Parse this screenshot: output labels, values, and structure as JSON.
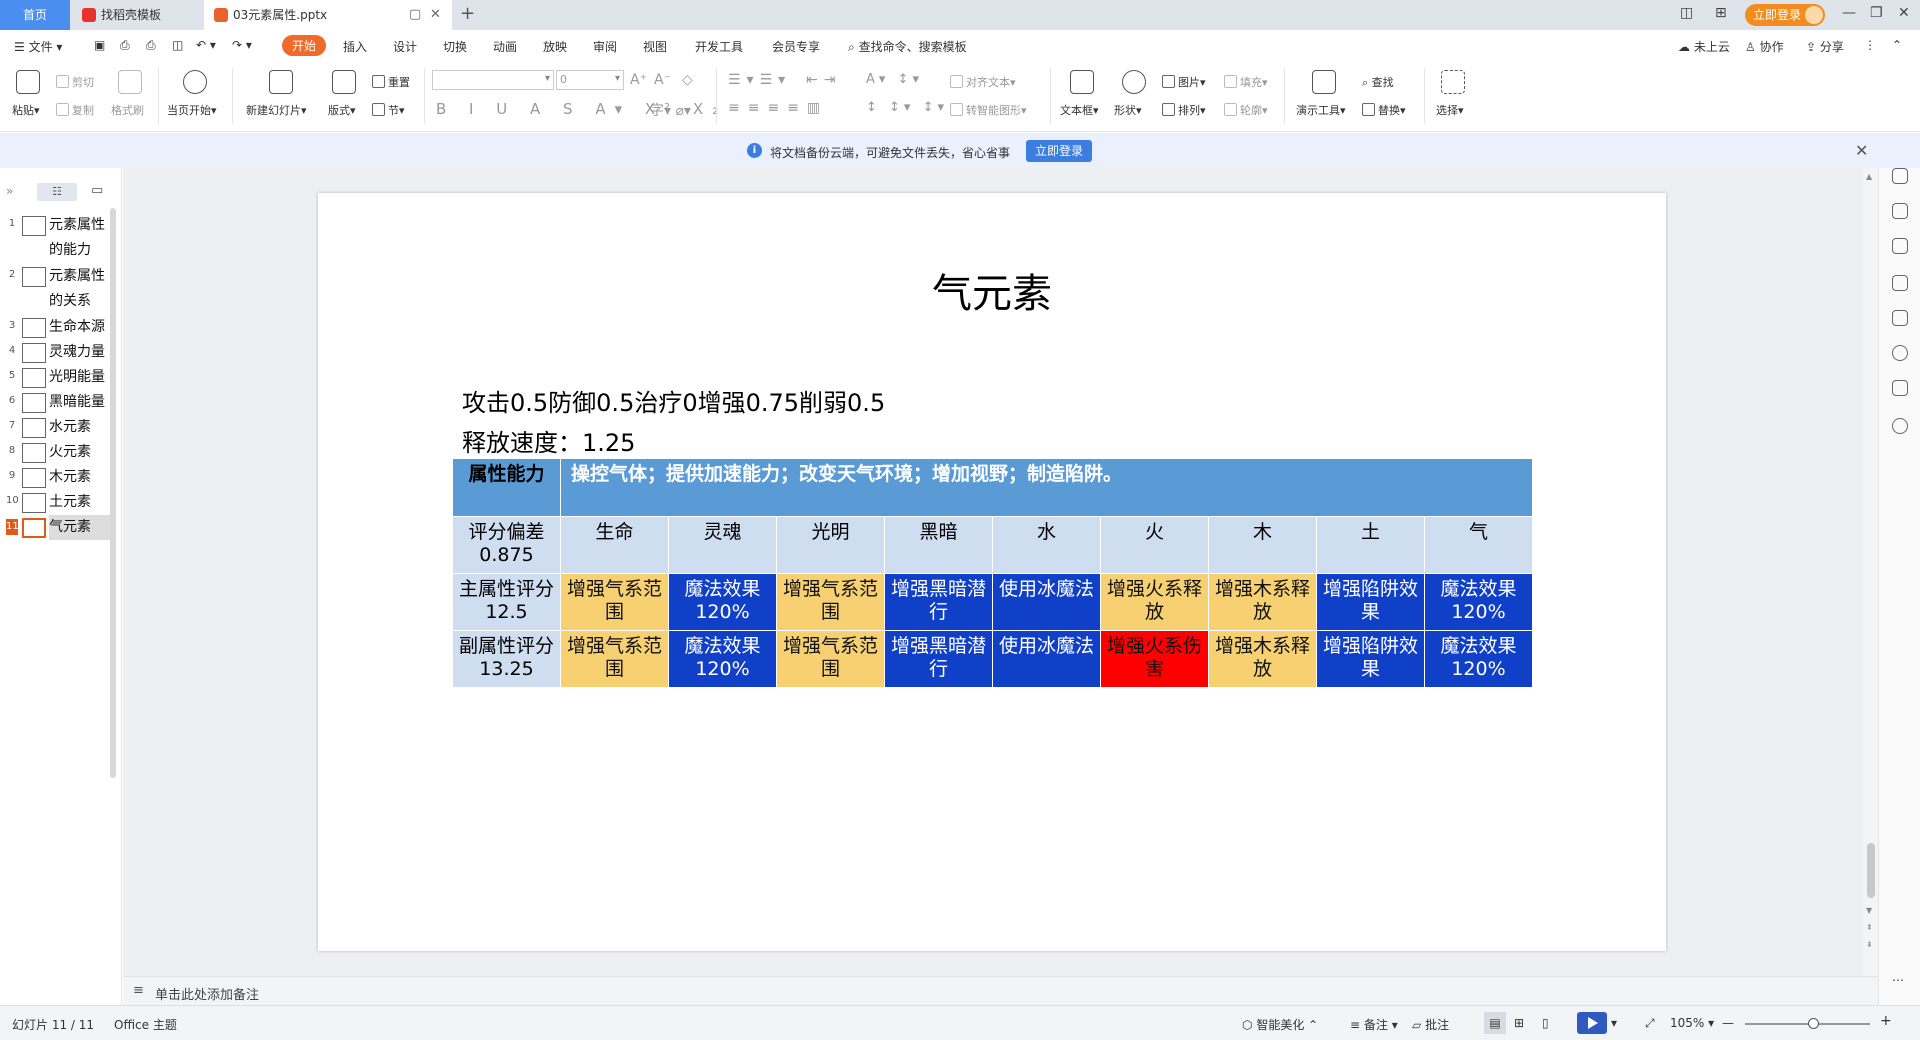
{
  "tabs": {
    "home": "首页",
    "template": "找稻壳模板",
    "document": "03元素属性.pptx"
  },
  "header": {
    "login_button": "立即登录"
  },
  "menu": {
    "file": "文件",
    "items": [
      "开始",
      "插入",
      "设计",
      "切换",
      "动画",
      "放映",
      "审阅",
      "视图",
      "开发工具",
      "会员专享"
    ],
    "search_placeholder": "查找命令、搜索模板",
    "cloud": "未上云",
    "collab": "协作",
    "share": "分享"
  },
  "toolbar": {
    "paste": "粘贴",
    "cut": "剪切",
    "copy": "复制",
    "format_painter": "格式刷",
    "start_from_first": "当页开始",
    "new_slide": "新建幻灯片",
    "layout": "版式",
    "reset": "重置",
    "section": "节",
    "font_size": "0",
    "align_text": "对齐文本",
    "smart_art": "转智能图形",
    "textbox": "文本框",
    "shape": "形状",
    "picture": "图片",
    "arrange": "排列",
    "fill": "填充",
    "outline": "轮廓",
    "presenter_tools": "演示工具",
    "find": "查找",
    "replace": "替换",
    "select": "选择"
  },
  "notice": {
    "text": "将文档备份云端，可避免文件丢失，省心省事",
    "button": "立即登录"
  },
  "slides": [
    {
      "num": "1",
      "label": "元素属性的能力"
    },
    {
      "num": "2",
      "label": "元素属性的关系"
    },
    {
      "num": "3",
      "label": "生命本源"
    },
    {
      "num": "4",
      "label": "灵魂力量"
    },
    {
      "num": "5",
      "label": "光明能量"
    },
    {
      "num": "6",
      "label": "黑暗能量"
    },
    {
      "num": "7",
      "label": "水元素"
    },
    {
      "num": "8",
      "label": "火元素"
    },
    {
      "num": "9",
      "label": "木元素"
    },
    {
      "num": "10",
      "label": "土元素"
    },
    {
      "num": "11",
      "label": "气元素"
    }
  ],
  "slide": {
    "title": "气元素",
    "line1": "攻击0.5防御0.5治疗0增强0.75削弱0.5",
    "line2": "释放速度：1.25",
    "table": {
      "header_label": "属性能力",
      "header_text": "操控气体；提供加速能力；改变天气环境；增加视野；制造陷阱。",
      "row_score": {
        "label": "评分偏差0.875",
        "cells": [
          "生命",
          "灵魂",
          "光明",
          "黑暗",
          "水",
          "火",
          "木",
          "土",
          "气"
        ]
      },
      "row_main": {
        "label": "主属性评分12.5",
        "cells": [
          "增强气系范围",
          "魔法效果120%",
          "增强气系范围",
          "增强黑暗潜行",
          "使用冰魔法",
          "增强火系释放",
          "增强木系释放",
          "增强陷阱效果",
          "魔法效果120%"
        ]
      },
      "row_sub": {
        "label": "副属性评分13.25",
        "cells": [
          "增强气系范围",
          "魔法效果120%",
          "增强气系范围",
          "增强黑暗潜行",
          "使用冰魔法",
          "增强火系伤害",
          "增强木系释放",
          "增强陷阱效果",
          "魔法效果120%"
        ]
      }
    }
  },
  "notes_placeholder": "单击此处添加备注",
  "status": {
    "slide_counter": "幻灯片 11 / 11",
    "theme": "Office 主题",
    "beautify": "智能美化",
    "notes": "备注",
    "comment": "批注",
    "zoom": "105%"
  },
  "colors": {
    "accent": "#f06a2a",
    "table_header": "#5b9bd5",
    "cell_yellow": "#f7d072",
    "cell_blue": "#1040c8",
    "cell_red": "#ff0000",
    "cell_lightblue": "#cfddf0"
  }
}
